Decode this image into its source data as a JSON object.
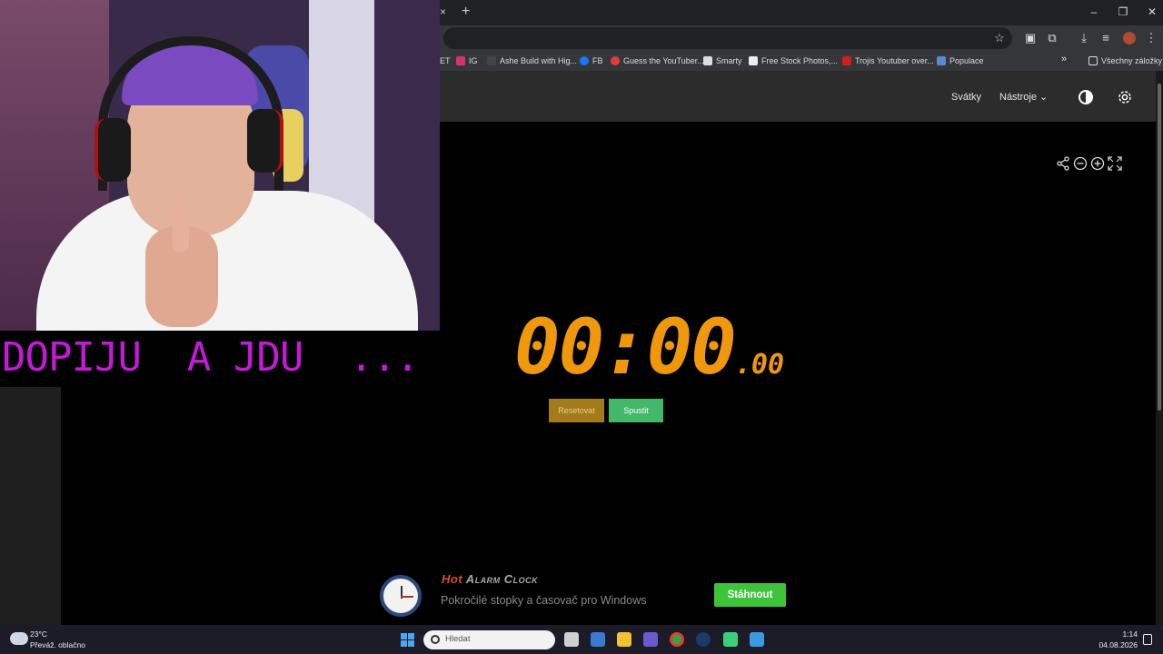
{
  "overlay": {
    "caption": "DOPIJU  A JDU  ..."
  },
  "browser": {
    "tab_close": "×",
    "new_tab": "+",
    "window_controls": {
      "minimize": "–",
      "restore": "❐",
      "close": "✕"
    },
    "bookmarks": [
      {
        "label": "ET",
        "color": "#888888"
      },
      {
        "label": "IG",
        "color": "#d6336c"
      },
      {
        "label": "Ashe Build with Hig...",
        "color": "#444444"
      },
      {
        "label": "FB",
        "color": "#1877f2"
      },
      {
        "label": "Guess the YouTuber...",
        "color": "#e03c3c"
      },
      {
        "label": "Smarty",
        "color": "#dddddd"
      },
      {
        "label": "Free Stock Photos,...",
        "color": "#eeeeee"
      },
      {
        "label": "Trojis Youtuber over...",
        "color": "#d01e1e"
      },
      {
        "label": "Populace",
        "color": "#5a8ad0"
      }
    ],
    "bookmarks_more": "»",
    "all_bookmarks": "Všechny záložky"
  },
  "site": {
    "nav": {
      "holidays": "Svátky",
      "tools": "Nástroje"
    }
  },
  "stopwatch": {
    "display_main": "00:00",
    "display_ms": ".00",
    "reset_label": "Resetovat",
    "start_label": "Spustit",
    "color": "#f0980c"
  },
  "ad": {
    "title_first": "Hot",
    "title_rest": " Alarm Clock",
    "subtitle": "Pokročilé stopky a časovač pro Windows",
    "button": "Stáhnout"
  },
  "taskbar": {
    "weather_temp": "23°C",
    "weather_desc": "Převáž. oblačno",
    "search_placeholder": "Hledat",
    "time": "1:14",
    "date": "04.08.2026",
    "apps": [
      {
        "name": "task-view-icon",
        "color": "#d0d0d0"
      },
      {
        "name": "store-icon",
        "color": "#3a7ad0"
      },
      {
        "name": "file-explorer-icon",
        "color": "#f2c230"
      },
      {
        "name": "teams-icon",
        "color": "#6a5ad0"
      },
      {
        "name": "chrome-icon",
        "color": "#2aa84a"
      },
      {
        "name": "steam-icon",
        "color": "#1a3a6a"
      },
      {
        "name": "discord-icon",
        "color": "#3ad07a"
      },
      {
        "name": "paint-icon",
        "color": "#3a9ae0"
      }
    ]
  }
}
